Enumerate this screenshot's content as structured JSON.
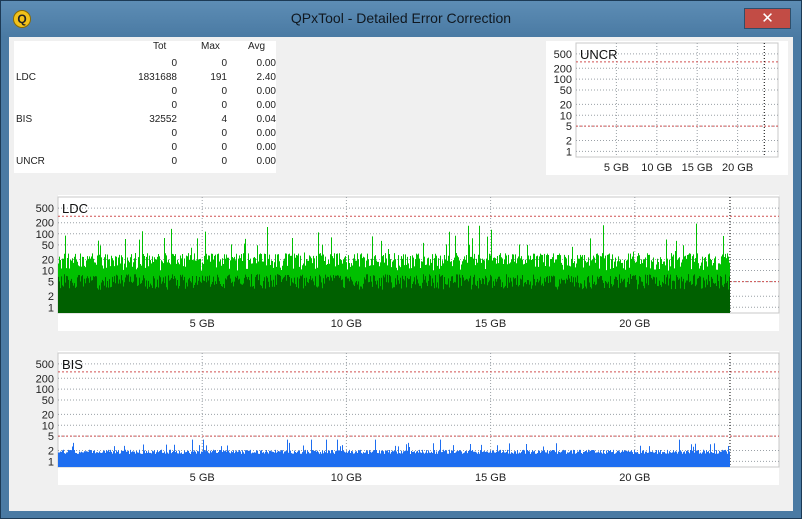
{
  "window": {
    "title": "QPxTool - Detailed Error Correction",
    "close_glyph": "✕",
    "app_icon": "Q"
  },
  "table": {
    "headers": [
      "Tot",
      "Max",
      "Avg"
    ],
    "rows": [
      {
        "label": "",
        "tot": "0",
        "max": "0",
        "avg": "0.00"
      },
      {
        "label": "LDC",
        "tot": "1831688",
        "max": "191",
        "avg": "2.40"
      },
      {
        "label": "",
        "tot": "0",
        "max": "0",
        "avg": "0.00"
      },
      {
        "label": "",
        "tot": "0",
        "max": "0",
        "avg": "0.00"
      },
      {
        "label": "BIS",
        "tot": "32552",
        "max": "4",
        "avg": "0.04"
      },
      {
        "label": "",
        "tot": "0",
        "max": "0",
        "avg": "0.00"
      },
      {
        "label": "",
        "tot": "0",
        "max": "0",
        "avg": "0.00"
      },
      {
        "label": "UNCR",
        "tot": "0",
        "max": "0",
        "avg": "0.00"
      }
    ]
  },
  "chart_data": [
    {
      "type": "bar",
      "title": "UNCR",
      "yscale": "log",
      "ylim": [
        0.7,
        1000
      ],
      "xlim": [
        0,
        25
      ],
      "yticks": [
        "1",
        "2",
        "5",
        "10",
        "20",
        "50",
        "100",
        "200",
        "500"
      ],
      "xticks": [
        "5 GB",
        "10 GB",
        "15 GB",
        "20 GB"
      ],
      "threshold_lines": [
        5,
        300
      ],
      "data_end_gb": 23.3,
      "series": [
        {
          "values": [
            0
          ]
        }
      ],
      "colors": {
        "threshold": "#d05050",
        "grid": "#9aa0a6"
      }
    },
    {
      "type": "bar",
      "title": "LDC",
      "yscale": "log",
      "ylim": [
        0.7,
        1000
      ],
      "xlim": [
        0,
        25
      ],
      "yticks": [
        "1",
        "2",
        "5",
        "10",
        "20",
        "50",
        "100",
        "200",
        "500"
      ],
      "xticks": [
        "5 GB",
        "10 GB",
        "15 GB",
        "20 GB"
      ],
      "threshold_lines": [
        5,
        300
      ],
      "data_end_gb": 23.3,
      "max": 191,
      "avg": 2.4,
      "typical_range": [
        10,
        30
      ],
      "series": [
        {
          "values": "dense per-sector counts, mostly 10-30 with spikes to ~191"
        }
      ],
      "colors": {
        "bar": "#00c000",
        "bar_dark": "#006000",
        "threshold": "#d05050",
        "grid": "#9aa0a6"
      }
    },
    {
      "type": "bar",
      "title": "BIS",
      "yscale": "log",
      "ylim": [
        0.7,
        1000
      ],
      "xlim": [
        0,
        25
      ],
      "yticks": [
        "1",
        "2",
        "5",
        "10",
        "20",
        "50",
        "100",
        "200",
        "500"
      ],
      "xticks": [
        "5 GB",
        "10 GB",
        "15 GB",
        "20 GB"
      ],
      "threshold_lines": [
        5,
        300
      ],
      "data_end_gb": 23.3,
      "max": 4,
      "avg": 0.04,
      "typical_range": [
        1,
        3
      ],
      "series": [
        {
          "values": "dense per-sector counts, mostly 1-2 with peaks to 4"
        }
      ],
      "colors": {
        "bar": "#1e6ef0",
        "threshold": "#d05050",
        "grid": "#9aa0a6"
      }
    }
  ]
}
